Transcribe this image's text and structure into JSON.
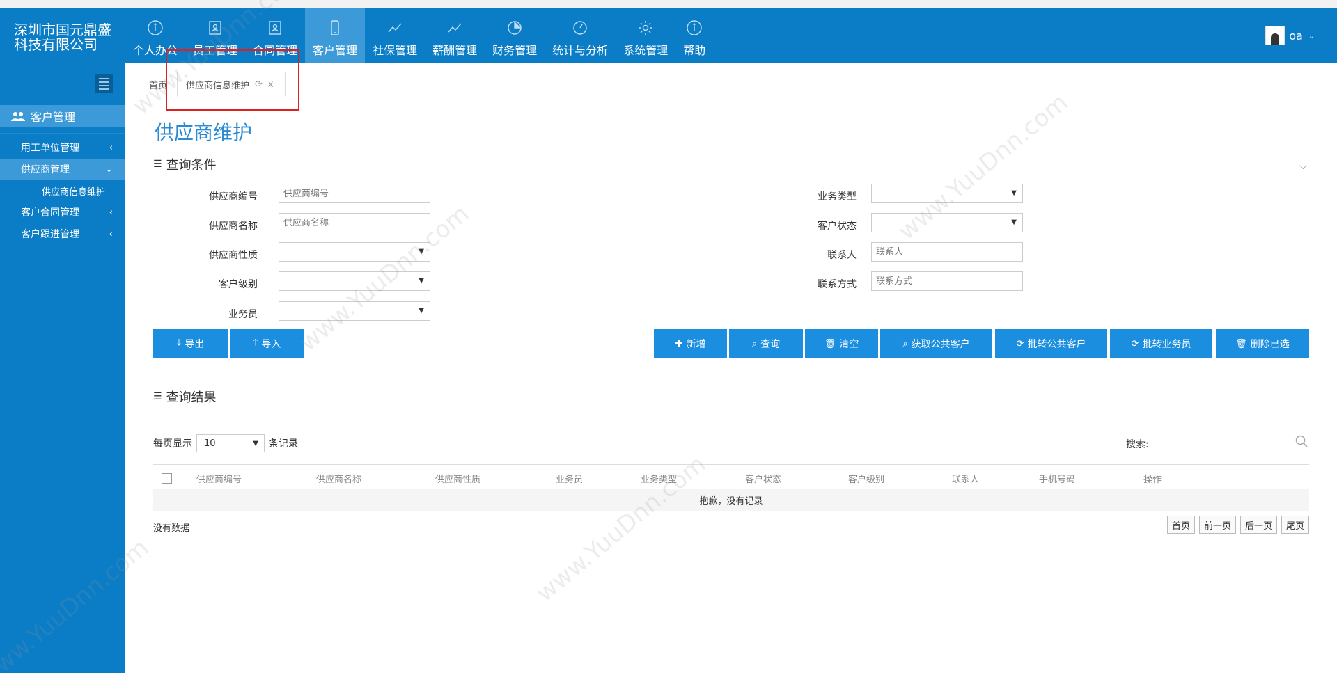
{
  "company": {
    "line1": "深圳市国元鼎盛",
    "line2": "科技有限公司"
  },
  "nav": [
    {
      "label": "个人办公",
      "icon": "info-icon",
      "active": false
    },
    {
      "label": "员工管理",
      "icon": "person-card-icon",
      "active": false
    },
    {
      "label": "合同管理",
      "icon": "person-card-icon",
      "active": false
    },
    {
      "label": "客户管理",
      "icon": "mobile-icon",
      "active": true
    },
    {
      "label": "社保管理",
      "icon": "line-chart-icon",
      "active": false
    },
    {
      "label": "薪酬管理",
      "icon": "line-chart-icon",
      "active": false
    },
    {
      "label": "财务管理",
      "icon": "pie-chart-icon",
      "active": false
    },
    {
      "label": "统计与分析",
      "icon": "dashboard-icon",
      "active": false
    },
    {
      "label": "系统管理",
      "icon": "gear-icon",
      "active": false
    },
    {
      "label": "帮助",
      "icon": "info-icon",
      "active": false
    }
  ],
  "user": {
    "name": "oa"
  },
  "sidebar": {
    "heading": "客户管理",
    "items": [
      {
        "label": "用工单位管理"
      },
      {
        "label": "供应商管理"
      },
      {
        "label": "供应商信息维护"
      },
      {
        "label": "客户合同管理"
      },
      {
        "label": "客户跟进管理"
      }
    ]
  },
  "tabs": {
    "home": "首页",
    "active": "供应商信息维护",
    "close": "x"
  },
  "page_title": "供应商维护",
  "query": {
    "section_title": "查询条件",
    "fields_left": [
      {
        "label": "供应商编号",
        "placeholder": "供应商编号"
      },
      {
        "label": "供应商名称",
        "placeholder": "供应商名称"
      },
      {
        "label": "供应商性质",
        "value": ""
      },
      {
        "label": "客户级别",
        "value": ""
      },
      {
        "label": "业务员",
        "value": ""
      }
    ],
    "fields_right": [
      {
        "label": "业务类型",
        "value": ""
      },
      {
        "label": "客户状态",
        "value": ""
      },
      {
        "label": "联系人",
        "placeholder": "联系人"
      },
      {
        "label": "联系方式",
        "placeholder": "联系方式"
      }
    ]
  },
  "buttons": {
    "export": "导出",
    "import": "导入",
    "add": "新增",
    "query": "查询",
    "clear": "清空",
    "get_public": "获取公共客户",
    "transfer_public": "批转公共客户",
    "transfer_sales": "批转业务员",
    "delete_selected": "删除已选"
  },
  "results": {
    "section_title": "查询结果",
    "per_page_label": "每页显示",
    "per_page_value": "10",
    "records_label": "条记录",
    "search_label": "搜索:",
    "columns": [
      "供应商编号",
      "供应商名称",
      "供应商性质",
      "业务员",
      "业务类型",
      "客户状态",
      "客户级别",
      "联系人",
      "手机号码",
      "操作"
    ],
    "empty_message": "抱歉，没有记录",
    "no_data": "没有数据",
    "pager": [
      "首页",
      "前一页",
      "后一页",
      "尾页"
    ]
  },
  "watermark": "www.YuuDnn.com",
  "colors": {
    "header": "#0b7dc6",
    "active": "#3c9ad8",
    "button": "#1b8ee0",
    "title": "#2a8ad4"
  }
}
